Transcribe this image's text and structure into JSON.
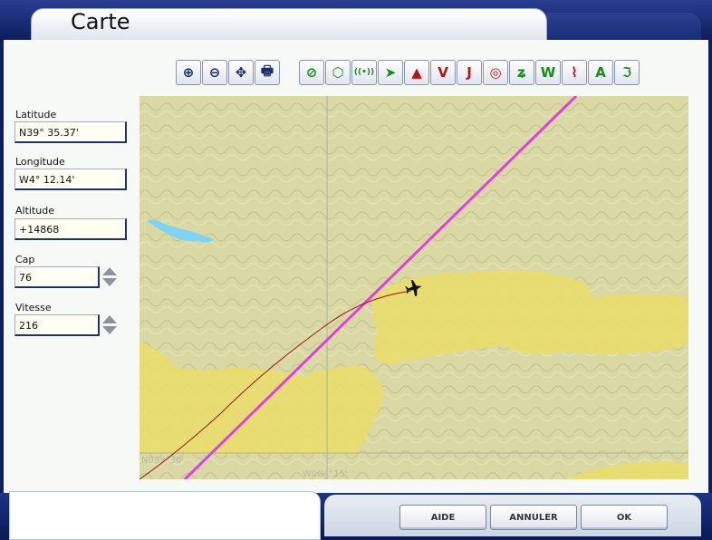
{
  "window": {
    "title": "Carte"
  },
  "toolbar": {
    "zoom_buttons": [
      {
        "icon": "zoom-in-icon",
        "glyph": "⊕"
      },
      {
        "icon": "zoom-out-icon",
        "glyph": "⊖"
      },
      {
        "icon": "center-aircraft-icon",
        "glyph": "✥"
      },
      {
        "icon": "print-icon",
        "glyph": "🖶"
      }
    ],
    "layer_buttons": [
      {
        "icon": "airport-icon",
        "glyph": "⊘",
        "color": "#1a8a1a"
      },
      {
        "icon": "vor-icon",
        "glyph": "⬡",
        "color": "#1a8a1a"
      },
      {
        "icon": "ndb-icon",
        "glyph": "((•))",
        "color": "#1a8a1a"
      },
      {
        "icon": "airway-icon",
        "glyph": "➤",
        "color": "#1a8a1a"
      },
      {
        "icon": "waypoint-triangle-icon",
        "glyph": "▲",
        "color": "#c01010"
      },
      {
        "icon": "victor-airway-icon",
        "glyph": "V",
        "color": "#c01010"
      },
      {
        "icon": "jet-airway-icon",
        "glyph": "J",
        "color": "#c01010"
      },
      {
        "icon": "airspace-icon",
        "glyph": "◎",
        "color": "#c01010"
      },
      {
        "icon": "route-icon",
        "glyph": "ʑ",
        "color": "#1a8a1a"
      },
      {
        "icon": "wind-icon",
        "glyph": "W",
        "color": "#1a8a1a"
      },
      {
        "icon": "terrain-icon",
        "glyph": "⌇",
        "color": "#c01010"
      },
      {
        "icon": "altitude-label-icon",
        "glyph": "A",
        "color": "#1a8a1a"
      },
      {
        "icon": "track-icon",
        "glyph": "ℑ",
        "color": "#1a8a1a"
      }
    ]
  },
  "fields": {
    "latitude": {
      "label": "Latitude",
      "value": "N39° 35.37'"
    },
    "longitude": {
      "label": "Longitude",
      "value": "W4° 12.14'"
    },
    "altitude": {
      "label": "Altitude",
      "value": "+14868"
    },
    "cap": {
      "label": "Cap",
      "value": "76"
    },
    "vitesse": {
      "label": "Vitesse",
      "value": "216"
    }
  },
  "map": {
    "lat_label": "N039°30'",
    "lon_label": "W004°15'",
    "colors": {
      "terrain": "#dad9a6",
      "highland": "#e9dd69",
      "route": "#e040e0",
      "track": "#a01010",
      "water": "#7fd3f2"
    }
  },
  "buttons": {
    "aide": "AIDE",
    "annuler": "ANNULER",
    "ok": "OK"
  }
}
